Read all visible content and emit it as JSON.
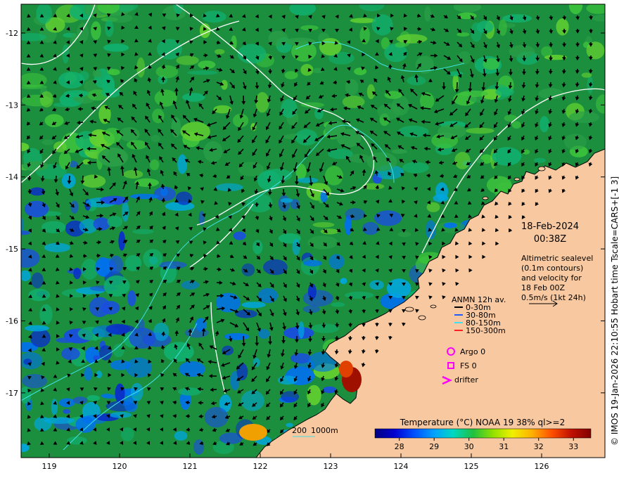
{
  "map": {
    "date": "18-Feb-2024",
    "time": "00:38Z",
    "description_lines": [
      "Altimetric sealevel",
      "(0.1m contours)",
      "and velocity for",
      "18 Feb 00Z",
      "0.5m/s (1kt 24h)"
    ],
    "lon_labels": [
      "119",
      "120",
      "121",
      "122",
      "123",
      "124",
      "125",
      "126"
    ],
    "lat_labels": [
      "-12",
      "-13",
      "-14",
      "-15",
      "-16",
      "-17"
    ],
    "lon_range": [
      118.6,
      126.9
    ],
    "lat_range": [
      -17.9,
      -11.6
    ]
  },
  "legend": {
    "title": "ANMN 12h av.",
    "items": [
      {
        "label": "0-30m",
        "color": "#000000"
      },
      {
        "label": "30-80m",
        "color": "#1e5bff"
      },
      {
        "label": "80-150m",
        "color": "#40e0f0"
      },
      {
        "label": "150-300m",
        "color": "#ff2020"
      }
    ],
    "argo": "Argo 0",
    "fs": "FS 0",
    "drifter": "drifter",
    "marker_color": "#ff00ff"
  },
  "colorbar": {
    "title": "Temperature (°C) NOAA 19 38% ql>=2",
    "ticks": [
      "28",
      "29",
      "30",
      "31",
      "32",
      "33"
    ],
    "range": [
      27.3,
      33.5
    ],
    "colors": [
      "#000080",
      "#0000d0",
      "#0050ff",
      "#00a0ff",
      "#00d8c0",
      "#20c040",
      "#90e000",
      "#f0f000",
      "#ffb000",
      "#ff5000",
      "#c01000",
      "#800000"
    ]
  },
  "bathymetry": {
    "label_200": "200",
    "label_1000": "1000m",
    "contour_color": "#40e0e0"
  },
  "credit": "© IMOS 19-Jan-2026 22:10:55 Hobart time Tscale=CARS+[-1 3]",
  "colors": {
    "land": "#f8c9a0",
    "sea_base": "#1c8f3e",
    "contour": "#ffffff"
  }
}
